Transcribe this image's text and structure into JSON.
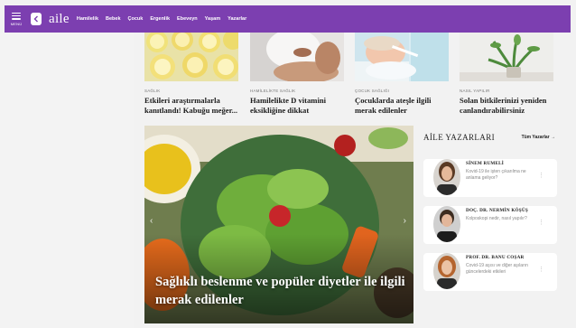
{
  "header": {
    "menu_label": "MENÜ",
    "brand": "aile",
    "nav": [
      "Hamilelik",
      "Bebek",
      "Çocuk",
      "Ergenlik",
      "Ebeveyn",
      "Yaşam",
      "Yazarlar"
    ]
  },
  "articles": [
    {
      "category": "SAĞLIK",
      "title": "Etkileri araştırmalarla kanıtlandı! Kabuğu meğer..."
    },
    {
      "category": "HAMİLELİKTE SAĞLIK",
      "title": "Hamilelikte D vitamini eksikliğine dikkat"
    },
    {
      "category": "ÇOCUK SAĞLIĞI",
      "title": "Çocuklarda ateşle ilgili merak edilenler"
    },
    {
      "category": "NASIL YAPILIR",
      "title": "Solan bitkilerinizi yeniden canlandırabilirsiniz"
    }
  ],
  "hero": {
    "title": "Sağlıklı beslenme ve popüler diyetler ile ilgili merak edilenler"
  },
  "writers": {
    "title": "AİLE YAZARLARI",
    "all_label": "Tüm Yazarlar →",
    "items": [
      {
        "name": "SİNEM RUMELİ",
        "desc": "Kovid-19 ile işten çıkarılma ne anlama geliyor?"
      },
      {
        "name": "DOÇ. DR. NERMİN KÖŞÜŞ",
        "desc": "Kolposkopi nedir, nasıl yapılır?"
      },
      {
        "name": "PROF. DR. BANU COŞAR",
        "desc": "Covid-19 aşısı ve diğer aşıların güncelerdeki etkileri"
      }
    ]
  },
  "colors": {
    "topbar": "#7c3fb0"
  },
  "icons": {
    "menu": "hamburger-icon",
    "back": "chevron-left-icon",
    "more": "more-vertical-icon"
  }
}
